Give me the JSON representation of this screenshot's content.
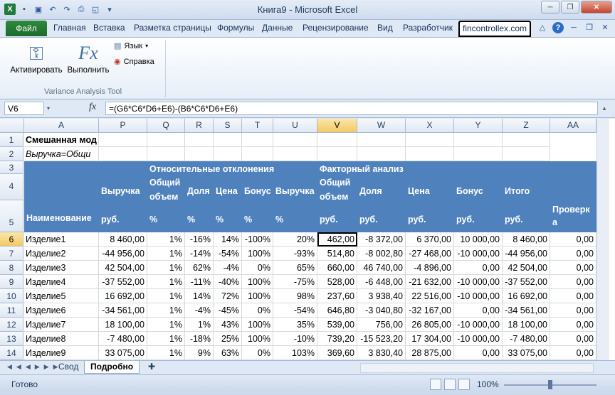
{
  "window": {
    "title": "Книга9  -  Microsoft Excel"
  },
  "tabs": {
    "file": "Файл",
    "items": [
      "Главная",
      "Вставка",
      "Разметка страницы",
      "Формулы",
      "Данные",
      "Рецензирование",
      "Вид",
      "Разработчик",
      "fincontrollex.com"
    ]
  },
  "ribbon": {
    "activate": "Активировать",
    "execute": "Выполнить",
    "language": "Язык",
    "help": "Справка",
    "group": "Variance Analysis Tool"
  },
  "formula_bar": {
    "cell_ref": "V6",
    "formula": "=(G6*C6*D6+E6)-(B6*C6*D6+E6)"
  },
  "columns": [
    "A",
    "P",
    "Q",
    "R",
    "S",
    "T",
    "U",
    "V",
    "W",
    "X",
    "Y",
    "Z",
    "AA"
  ],
  "rows_nums": [
    "1",
    "2",
    "3",
    "4",
    "5",
    "6",
    "7",
    "8",
    "9",
    "10",
    "11",
    "12",
    "13",
    "14"
  ],
  "top": {
    "a1": "Смешанная мод",
    "a2": "Выручка=Общи"
  },
  "headers": {
    "naim": "Наименование",
    "vyr": "Выручка",
    "rub": "руб.",
    "otn": "Относительные отклонения",
    "obsh1": "Общий",
    "obsh2": "объем",
    "dolya": "Доля",
    "cena": "Цена",
    "bonus": "Бонус",
    "vyruchka": "Выручка",
    "pct": "%",
    "fakt": "Факторный анализ",
    "itogo": "Итого",
    "prov1": "Проверк",
    "prov2": "а"
  },
  "rows": [
    [
      "Изделие1",
      "8 460,00",
      "1%",
      "-16%",
      "14%",
      "-100%",
      "20%",
      "462,00",
      "-8 372,00",
      "6 370,00",
      "10 000,00",
      "8 460,00",
      "0,00"
    ],
    [
      "Изделие2",
      "-44 956,00",
      "1%",
      "-14%",
      "-54%",
      "100%",
      "-93%",
      "514,80",
      "-8 002,80",
      "-27 468,00",
      "-10 000,00",
      "-44 956,00",
      "0,00"
    ],
    [
      "Изделие3",
      "42 504,00",
      "1%",
      "62%",
      "-4%",
      "0%",
      "65%",
      "660,00",
      "46 740,00",
      "-4 896,00",
      "0,00",
      "42 504,00",
      "0,00"
    ],
    [
      "Изделие4",
      "-37 552,00",
      "1%",
      "-11%",
      "-40%",
      "100%",
      "-75%",
      "528,00",
      "-6 448,00",
      "-21 632,00",
      "-10 000,00",
      "-37 552,00",
      "0,00"
    ],
    [
      "Изделие5",
      "16 692,00",
      "1%",
      "14%",
      "72%",
      "100%",
      "98%",
      "237,60",
      "3 938,40",
      "22 516,00",
      "-10 000,00",
      "16 692,00",
      "0,00"
    ],
    [
      "Изделие6",
      "-34 561,00",
      "1%",
      "-4%",
      "-45%",
      "0%",
      "-54%",
      "646,80",
      "-3 040,80",
      "-32 167,00",
      "0,00",
      "-34 561,00",
      "0,00"
    ],
    [
      "Изделие7",
      "18 100,00",
      "1%",
      "1%",
      "43%",
      "100%",
      "35%",
      "539,00",
      "756,00",
      "26 805,00",
      "-10 000,00",
      "18 100,00",
      "0,00"
    ],
    [
      "Изделие8",
      "-7 480,00",
      "1%",
      "-18%",
      "25%",
      "100%",
      "-10%",
      "739,20",
      "-15 523,20",
      "17 304,00",
      "-10 000,00",
      "-7 480,00",
      "0,00"
    ],
    [
      "Изделие9",
      "33 075,00",
      "1%",
      "9%",
      "63%",
      "0%",
      "103%",
      "369,60",
      "3 830,40",
      "28 875,00",
      "0,00",
      "33 075,00",
      "0,00"
    ]
  ],
  "sheets": [
    "Свод",
    "Подробно"
  ],
  "status": {
    "ready": "Готово",
    "zoom": "100%"
  }
}
